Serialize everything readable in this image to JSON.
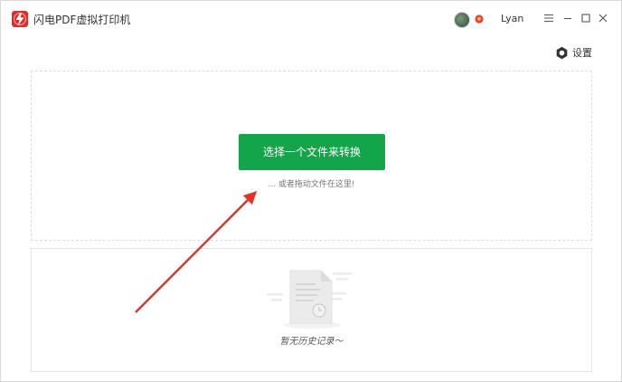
{
  "window": {
    "title": "闪电PDF虚拟打印机",
    "user": {
      "name": "Lyan"
    },
    "controls": {
      "menu_icon": "menu-icon",
      "minimize_icon": "minimize-icon",
      "maximize_icon": "maximize-icon",
      "close_icon": "close-icon"
    }
  },
  "toolbar": {
    "settings_label": "设置",
    "settings_icon": "gear-icon"
  },
  "dropzone": {
    "select_button_label": "选择一个文件来转换",
    "drag_hint": "... 或者拖动文件在这里!"
  },
  "history": {
    "empty_text": "暂无历史记录～",
    "illustration_icon": "empty-document-icon"
  },
  "colors": {
    "brand_red": "#e02b2b",
    "primary_green": "#13a54a",
    "annotation_arrow": "#e5302a"
  }
}
